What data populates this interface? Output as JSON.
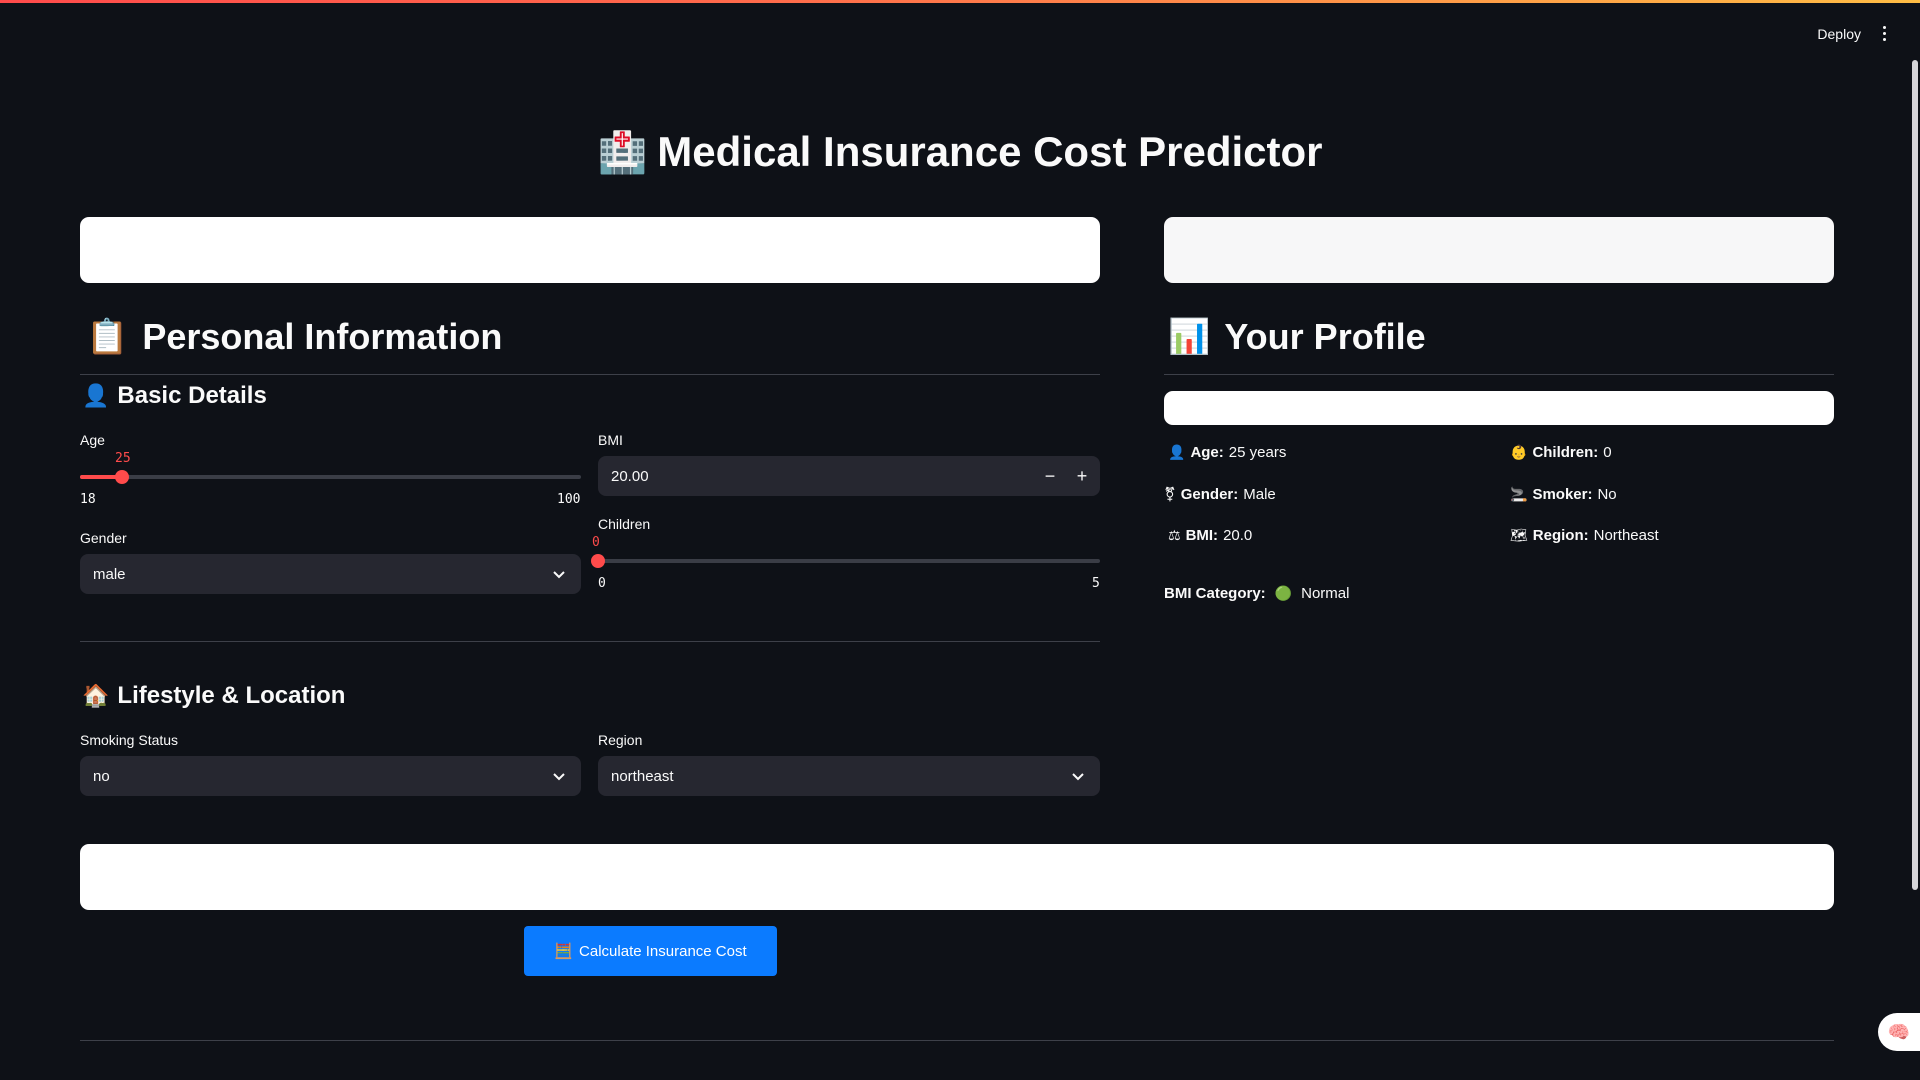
{
  "header": {
    "deploy_label": "Deploy",
    "menu_icon": "kebab-menu-icon"
  },
  "title": {
    "emoji": "🏥",
    "text": "Medical Insurance Cost Predictor"
  },
  "personal": {
    "emoji": "📋",
    "heading": "Personal Information",
    "basic": {
      "emoji": "👤",
      "heading": "Basic Details"
    },
    "age": {
      "label": "Age",
      "value": "25",
      "min": "18",
      "max": "100"
    },
    "bmi": {
      "label": "BMI",
      "value": "20.00",
      "minus": "−",
      "plus": "+"
    },
    "gender": {
      "label": "Gender",
      "value": "male"
    },
    "children": {
      "label": "Children",
      "value": "0",
      "min": "0",
      "max": "5"
    },
    "lifestyle": {
      "emoji": "🏠",
      "heading": "Lifestyle & Location"
    },
    "smoking": {
      "label": "Smoking Status",
      "value": "no"
    },
    "region": {
      "label": "Region",
      "value": "northeast"
    }
  },
  "profile": {
    "emoji": "📊",
    "heading": "Your Profile",
    "age": {
      "emoji": "👤",
      "key": "Age:",
      "value": "25 years"
    },
    "children": {
      "emoji": "👶",
      "key": "Children:",
      "value": "0"
    },
    "gender": {
      "emoji": "⚧",
      "key": "Gender:",
      "value": "Male"
    },
    "smoker": {
      "emoji": "🚬",
      "key": "Smoker:",
      "value": "No"
    },
    "bmi": {
      "emoji": "⚖",
      "key": "BMI:",
      "value": "20.0"
    },
    "region": {
      "emoji": "🗺",
      "key": "Region:",
      "value": "Northeast"
    },
    "bmi_category": {
      "key": "BMI Category:",
      "emoji": "🟢",
      "value": "Normal"
    }
  },
  "calculate": {
    "emoji": "🧮",
    "label": "Calculate Insurance Cost"
  },
  "fab_icon": "brain-icon",
  "colors": {
    "accent": "#ff4b4b",
    "primary_button": "#0b7bff",
    "background": "#0e1117",
    "field": "#262730"
  }
}
